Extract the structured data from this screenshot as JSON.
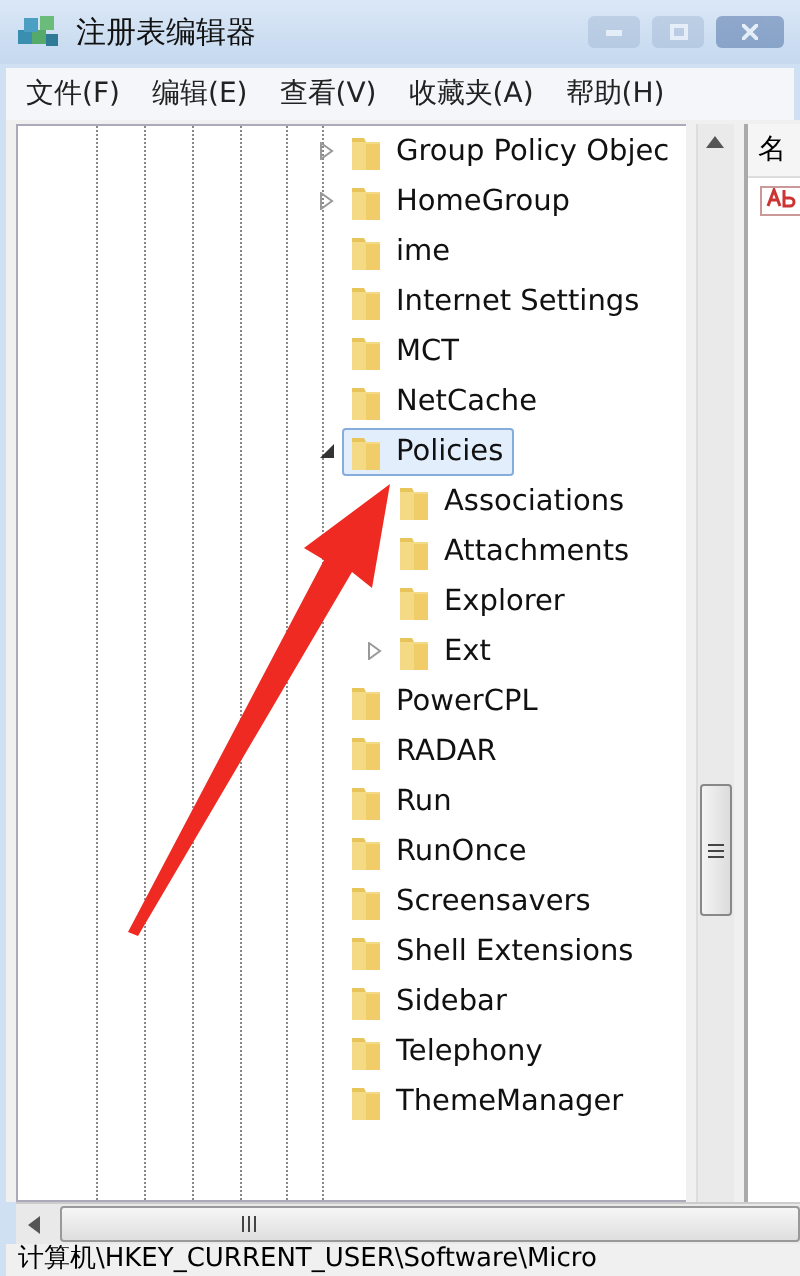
{
  "window": {
    "title": "注册表编辑器"
  },
  "menu": [
    "文件(F)",
    "编辑(E)",
    "查看(V)",
    "收藏夹(A)",
    "帮助(H)"
  ],
  "tree": [
    {
      "label": "Group Policy Objec",
      "expanded": false,
      "selected": false
    },
    {
      "label": "HomeGroup",
      "expanded": false,
      "selected": false
    },
    {
      "label": "ime",
      "selected": false
    },
    {
      "label": "Internet Settings",
      "selected": false
    },
    {
      "label": "MCT",
      "selected": false
    },
    {
      "label": "NetCache",
      "selected": false
    },
    {
      "label": "Policies",
      "expanded": true,
      "selected": true,
      "children": [
        {
          "label": "Associations",
          "selected": false
        },
        {
          "label": "Attachments",
          "selected": false
        },
        {
          "label": "Explorer",
          "selected": false
        },
        {
          "label": "Ext",
          "expanded": false,
          "selected": false
        }
      ]
    },
    {
      "label": "PowerCPL",
      "selected": false
    },
    {
      "label": "RADAR",
      "selected": false
    },
    {
      "label": "Run",
      "selected": false
    },
    {
      "label": "RunOnce",
      "selected": false
    },
    {
      "label": "Screensavers",
      "selected": false
    },
    {
      "label": "Shell Extensions",
      "selected": false
    },
    {
      "label": "Sidebar",
      "selected": false
    },
    {
      "label": "Telephony",
      "selected": false
    },
    {
      "label": "ThemeManager",
      "selected": false
    }
  ],
  "values_pane": {
    "column_1": "名"
  },
  "annotation": {
    "kind": "arrow"
  },
  "status_bar": "计算机\\HKEY_CURRENT_USER\\Software\\Micro"
}
